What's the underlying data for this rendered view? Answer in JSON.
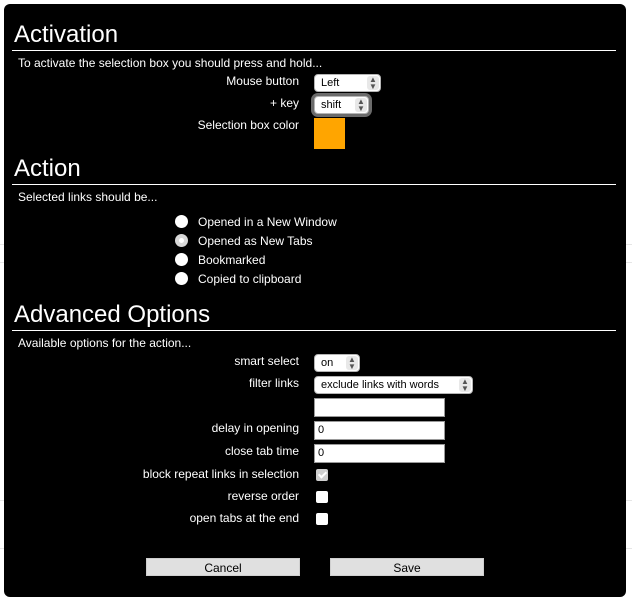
{
  "activation": {
    "title": "Activation",
    "intro": "To activate the selection box you should press and hold...",
    "mouse_button_label": "Mouse button",
    "mouse_button_value": "Left",
    "key_label": "+ key",
    "key_value": "shift",
    "color_label": "Selection box color",
    "color": "#ffa500"
  },
  "action": {
    "title": "Action",
    "intro": "Selected links should be...",
    "options": [
      {
        "label": "Opened in a New Window",
        "selected": false
      },
      {
        "label": "Opened as New Tabs",
        "selected": true
      },
      {
        "label": "Bookmarked",
        "selected": false
      },
      {
        "label": "Copied to clipboard",
        "selected": false
      }
    ]
  },
  "advanced": {
    "title": "Advanced Options",
    "intro": "Available options for the action...",
    "smart_select_label": "smart select",
    "smart_select_value": "on",
    "filter_links_label": "filter links",
    "filter_links_value": "exclude links with words",
    "filter_words_value": "",
    "delay_label": "delay in opening",
    "delay_value": "0",
    "close_tab_label": "close tab time",
    "close_tab_value": "0",
    "block_repeat_label": "block repeat links in selection",
    "block_repeat_checked": true,
    "reverse_order_label": "reverse order",
    "reverse_order_checked": false,
    "open_at_end_label": "open tabs at the end",
    "open_at_end_checked": false
  },
  "buttons": {
    "cancel": "Cancel",
    "save": "Save"
  }
}
